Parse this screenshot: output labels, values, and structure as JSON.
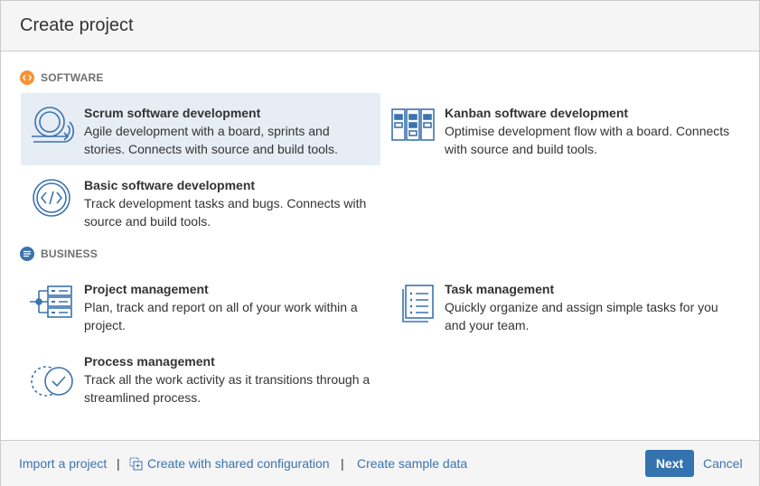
{
  "dialog": {
    "title": "Create project"
  },
  "sections": {
    "software": {
      "label": "SOFTWARE",
      "icon": "code-brackets-icon",
      "color": "#f79232",
      "items": [
        {
          "title": "Scrum software development",
          "desc": "Agile development with a board, sprints and stories. Connects with source and build tools.",
          "icon": "scrum-cycle-icon",
          "selected": true
        },
        {
          "title": "Kanban software development",
          "desc": "Optimise development flow with a board. Connects with source and build tools.",
          "icon": "kanban-board-icon"
        },
        {
          "title": "Basic software development",
          "desc": "Track development tasks and bugs. Connects with source and build tools.",
          "icon": "code-icon"
        }
      ]
    },
    "business": {
      "label": "BUSINESS",
      "icon": "list-icon",
      "color": "#3b73af",
      "items": [
        {
          "title": "Project management",
          "desc": "Plan, track and report on all of your work within a project.",
          "icon": "project-tree-icon"
        },
        {
          "title": "Task management",
          "desc": "Quickly organize and assign simple tasks for you and your team.",
          "icon": "task-list-icon"
        },
        {
          "title": "Process management",
          "desc": "Track all the work activity as it transitions through a streamlined process.",
          "icon": "process-check-icon"
        }
      ]
    }
  },
  "footer": {
    "import_label": "Import a project",
    "separator": "|",
    "shared_config_label": "Create with shared configuration",
    "sample_data_label": "Create sample data",
    "next_label": "Next",
    "cancel_label": "Cancel"
  },
  "colors": {
    "accent": "#3572b0",
    "icon_stroke": "#3b73af",
    "selected_bg": "#e6edf5"
  }
}
